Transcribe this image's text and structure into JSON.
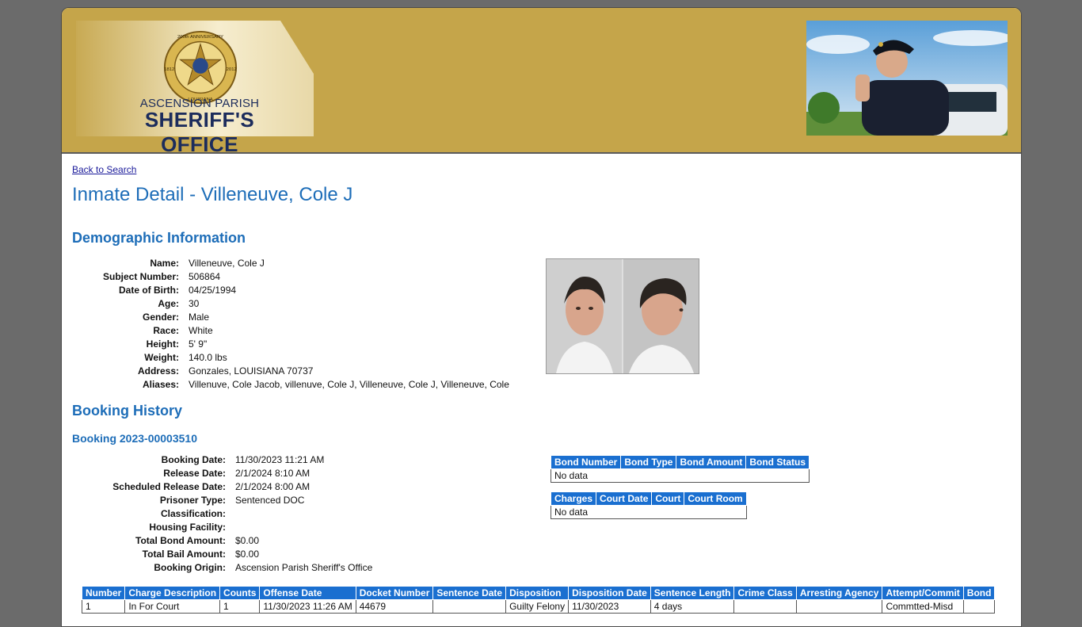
{
  "header": {
    "logo_line1": "ASCENSION PARISH",
    "logo_line2": "SHERIFF'S OFFICE",
    "badge_top_text": "200th ANNIVERSARY",
    "badge_left_text": "1812",
    "badge_right_text": "2012",
    "badge_bottom_text": "LOUISIANA"
  },
  "nav": {
    "back_link": "Back to Search"
  },
  "page_title": "Inmate Detail - Villeneuve, Cole J",
  "demographics": {
    "heading": "Demographic Information",
    "fields": [
      {
        "label": "Name:",
        "value": "Villeneuve, Cole J"
      },
      {
        "label": "Subject Number:",
        "value": "506864"
      },
      {
        "label": "Date of Birth:",
        "value": "04/25/1994"
      },
      {
        "label": "Age:",
        "value": "30"
      },
      {
        "label": "Gender:",
        "value": "Male"
      },
      {
        "label": "Race:",
        "value": "White"
      },
      {
        "label": "Height:",
        "value": "5' 9\""
      },
      {
        "label": "Weight:",
        "value": "140.0 lbs"
      },
      {
        "label": "Address:",
        "value": "Gonzales, LOUISIANA 70737"
      },
      {
        "label": "Aliases:",
        "value": "Villenuve, Cole Jacob, villenuve, Cole J, Villeneuve, Cole J, Villeneuve, Cole"
      }
    ]
  },
  "booking_history": {
    "heading": "Booking History",
    "booking_title": "Booking 2023-00003510",
    "fields": [
      {
        "label": "Booking Date:",
        "value": "11/30/2023 11:21 AM"
      },
      {
        "label": "Release Date:",
        "value": "2/1/2024 8:10 AM"
      },
      {
        "label": "Scheduled Release Date:",
        "value": "2/1/2024 8:00 AM"
      },
      {
        "label": "Prisoner Type:",
        "value": "Sentenced DOC"
      },
      {
        "label": "Classification:",
        "value": ""
      },
      {
        "label": "Housing Facility:",
        "value": ""
      },
      {
        "label": "Total Bond Amount:",
        "value": "$0.00"
      },
      {
        "label": "Total Bail Amount:",
        "value": "$0.00"
      },
      {
        "label": "Booking Origin:",
        "value": "Ascension Parish Sheriff's Office"
      }
    ],
    "bond_table": {
      "headers": [
        "Bond Number",
        "Bond Type",
        "Bond Amount",
        "Bond Status"
      ],
      "empty_text": "No data"
    },
    "court_table": {
      "headers": [
        "Charges",
        "Court Date",
        "Court",
        "Court Room"
      ],
      "empty_text": "No data"
    },
    "charges_table": {
      "headers": [
        "Number",
        "Charge Description",
        "Counts",
        "Offense Date",
        "Docket Number",
        "Sentence Date",
        "Disposition",
        "Disposition Date",
        "Sentence Length",
        "Crime Class",
        "Arresting Agency",
        "Attempt/Commit",
        "Bond"
      ],
      "rows": [
        [
          "1",
          "In For Court",
          "1",
          "11/30/2023 11:26 AM",
          "44679",
          "",
          "Guilty Felony",
          "11/30/2023",
          "4 days",
          "",
          "",
          "Commtted-Misd",
          ""
        ]
      ]
    }
  }
}
